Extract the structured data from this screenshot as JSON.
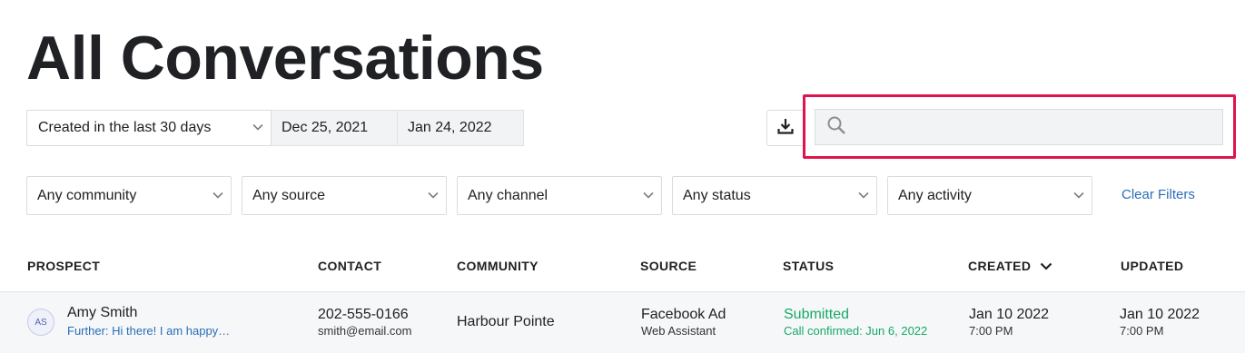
{
  "page": {
    "title": "All Conversations"
  },
  "date_range": {
    "preset": "Created in the last 30 days",
    "start": "Dec 25, 2021",
    "end": "Jan 24, 2022"
  },
  "search": {
    "value": "",
    "placeholder": ""
  },
  "filters": [
    {
      "label": "Any community"
    },
    {
      "label": "Any source"
    },
    {
      "label": "Any channel"
    },
    {
      "label": "Any status"
    },
    {
      "label": "Any activity"
    }
  ],
  "clear_filters_label": "Clear Filters",
  "table": {
    "columns": [
      "PROSPECT",
      "CONTACT",
      "COMMUNITY",
      "SOURCE",
      "STATUS",
      "CREATED",
      "UPDATED"
    ],
    "rows": [
      {
        "initials": "AS",
        "name": "Amy Smith",
        "preview": "Further: Hi there! I am happy…",
        "phone": "202-555-0166",
        "email": "smith@email.com",
        "community": "Harbour Pointe",
        "source": "Facebook Ad",
        "source_detail": "Web Assistant",
        "status": "Submitted",
        "status_detail": "Call confirmed: Jun 6, 2022",
        "created_date": "Jan 10 2022",
        "created_time": "7:00 PM",
        "updated_date": "Jan 10 2022",
        "updated_time": "7:00 PM"
      }
    ]
  },
  "colors": {
    "accent_link": "#2a6eb8",
    "status_green": "#17a968",
    "highlight_red": "#e0144c"
  },
  "icons": {
    "download": "download-icon",
    "search": "search-icon",
    "chevron": "chevron-down-icon",
    "sort": "sort-desc-icon"
  }
}
